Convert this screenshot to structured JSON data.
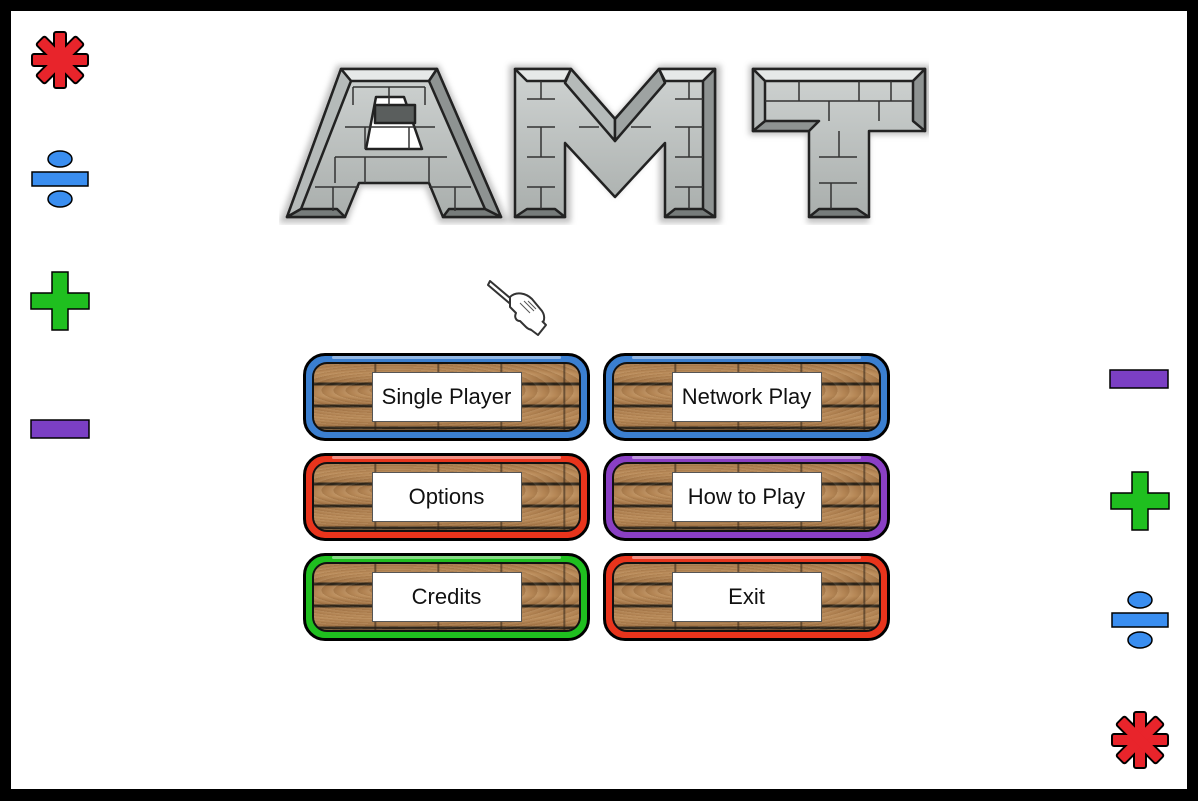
{
  "logo": {
    "text": "AMT"
  },
  "menu": {
    "buttons": [
      {
        "label": "Single Player",
        "color": "#3b7fd0"
      },
      {
        "label": "Network Play",
        "color": "#3b7fd0"
      },
      {
        "label": "Options",
        "color": "#e8341c"
      },
      {
        "label": "How to Play",
        "color": "#8a3fc4"
      },
      {
        "label": "Credits",
        "color": "#1fbf1f"
      },
      {
        "label": "Exit",
        "color": "#e8341c"
      }
    ]
  },
  "decorations": {
    "left": [
      "multiply-icon",
      "divide-icon",
      "plus-icon",
      "minus-icon"
    ],
    "right": [
      "minus-icon",
      "plus-icon",
      "divide-icon",
      "multiply-icon"
    ],
    "colors": {
      "multiply": "#e8242b",
      "divide": "#3a8ef0",
      "plus": "#1fbf1f",
      "minus": "#7b3fc4"
    }
  },
  "cursor": {
    "icon": "pointing-hand-cursor-icon"
  }
}
